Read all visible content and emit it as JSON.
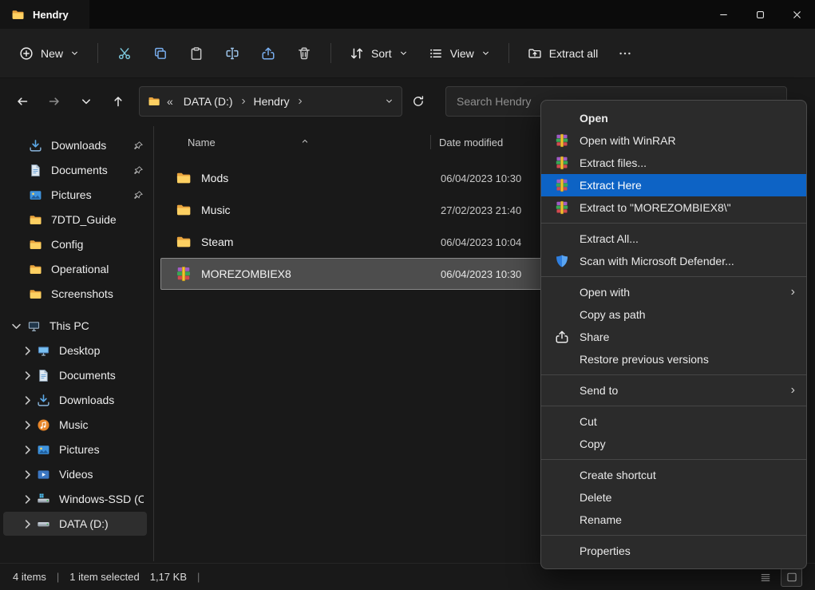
{
  "window": {
    "title": "Hendry",
    "icon": "folder-icon",
    "controls": [
      {
        "name": "minimize-button",
        "icon": "minimize-icon"
      },
      {
        "name": "maximize-button",
        "icon": "maximize-icon"
      },
      {
        "name": "close-button",
        "icon": "close-icon"
      }
    ]
  },
  "toolbar": {
    "new_button": {
      "label": "New",
      "icon": "plus-circle-icon"
    },
    "action_buttons": [
      {
        "name": "cut-button",
        "icon": "cut-icon"
      },
      {
        "name": "copy-button",
        "icon": "copy-icon"
      },
      {
        "name": "paste-button",
        "icon": "paste-icon"
      },
      {
        "name": "rename-button",
        "icon": "rename-icon"
      },
      {
        "name": "share-button",
        "icon": "share-icon"
      },
      {
        "name": "delete-button",
        "icon": "delete-icon"
      }
    ],
    "sort_button": {
      "label": "Sort",
      "icon": "sort-icon"
    },
    "view_button": {
      "label": "View",
      "icon": "view-icon"
    },
    "extract_all_button": {
      "label": "Extract all",
      "icon": "extract-all-icon"
    },
    "more_button": {
      "name": "more-options-button",
      "icon": "more-icon"
    }
  },
  "address_bar": {
    "nav_buttons": [
      {
        "name": "back-button",
        "icon": "back-icon"
      },
      {
        "name": "forward-button",
        "icon": "forward-icon",
        "disabled": true
      },
      {
        "name": "recent-locations-button",
        "icon": "chevron-down-icon"
      },
      {
        "name": "up-button",
        "icon": "up-icon"
      }
    ],
    "overflow_indicator": "«",
    "crumbs": [
      "DATA (D:)",
      "Hendry"
    ],
    "search_placeholder": "Search Hendry"
  },
  "sidebar": {
    "quick_access": [
      {
        "label": "Downloads",
        "icon": "downloads-icon",
        "pinned": true
      },
      {
        "label": "Documents",
        "icon": "documents-icon",
        "pinned": true
      },
      {
        "label": "Pictures",
        "icon": "pictures-icon",
        "pinned": true
      },
      {
        "label": "7DTD_Guide",
        "icon": "folder-icon"
      },
      {
        "label": "Config",
        "icon": "folder-icon"
      },
      {
        "label": "Operational",
        "icon": "folder-icon"
      },
      {
        "label": "Screenshots",
        "icon": "folder-icon"
      }
    ],
    "this_pc": {
      "label": "This PC",
      "icon": "computer-icon",
      "expanded": true,
      "children": [
        {
          "label": "Desktop",
          "icon": "desktop-icon"
        },
        {
          "label": "Documents",
          "icon": "documents-icon"
        },
        {
          "label": "Downloads",
          "icon": "downloads-icon"
        },
        {
          "label": "Music",
          "icon": "music-icon"
        },
        {
          "label": "Pictures",
          "icon": "pictures-icon"
        },
        {
          "label": "Videos",
          "icon": "videos-icon"
        },
        {
          "label": "Windows-SSD (C:)",
          "icon": "windows-drive-icon"
        },
        {
          "label": "DATA (D:)",
          "icon": "drive-icon",
          "selected": true
        }
      ]
    }
  },
  "file_list": {
    "columns": [
      {
        "label": "Name",
        "sort": "ascending"
      },
      {
        "label": "Date modified"
      }
    ],
    "rows": [
      {
        "name": "Mods",
        "icon": "folder-icon",
        "date_modified": "06/04/2023 10:30"
      },
      {
        "name": "Music",
        "icon": "folder-icon",
        "date_modified": "27/02/2023 21:40"
      },
      {
        "name": "Steam",
        "icon": "folder-icon",
        "date_modified": "06/04/2023 10:04"
      },
      {
        "name": "MOREZOMBIEX8",
        "icon": "winrar-icon",
        "date_modified": "06/04/2023 10:30",
        "selected": true
      }
    ]
  },
  "context_menu": {
    "highlight_color": "#0d63c5",
    "groups": [
      [
        {
          "label": "Open",
          "bold": true
        },
        {
          "label": "Open with WinRAR",
          "icon": "winrar-icon"
        },
        {
          "label": "Extract files...",
          "icon": "winrar-icon"
        },
        {
          "label": "Extract Here",
          "icon": "winrar-icon",
          "highlighted": true
        },
        {
          "label": "Extract to \"MOREZOMBIEX8\\\"",
          "icon": "winrar-icon"
        }
      ],
      [
        {
          "label": "Extract All..."
        },
        {
          "label": "Scan with Microsoft Defender...",
          "icon": "defender-icon"
        }
      ],
      [
        {
          "label": "Open with",
          "submenu": true
        },
        {
          "label": "Copy as path"
        },
        {
          "label": "Share",
          "icon": "share-icon"
        },
        {
          "label": "Restore previous versions"
        }
      ],
      [
        {
          "label": "Send to",
          "submenu": true
        }
      ],
      [
        {
          "label": "Cut"
        },
        {
          "label": "Copy"
        }
      ],
      [
        {
          "label": "Create shortcut"
        },
        {
          "label": "Delete"
        },
        {
          "label": "Rename"
        }
      ],
      [
        {
          "label": "Properties"
        }
      ]
    ]
  },
  "status_bar": {
    "items_count": "4 items",
    "selection_count": "1 item selected",
    "selection_size": "1,17 KB",
    "view_buttons": [
      {
        "name": "details-view-button",
        "icon": "details-view-icon"
      },
      {
        "name": "thumbnails-view-button",
        "icon": "thumbnails-view-icon",
        "active": true
      }
    ]
  }
}
